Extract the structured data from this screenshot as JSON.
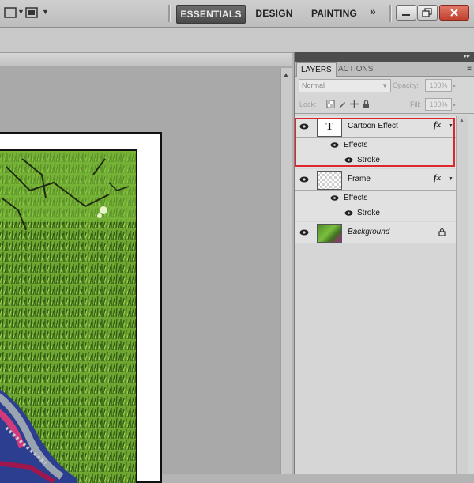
{
  "workspace": {
    "items": [
      "ESSENTIALS",
      "DESIGN",
      "PAINTING"
    ],
    "more": "»"
  },
  "layers_panel": {
    "tabs": [
      "LAYERS",
      "ACTIONS"
    ],
    "blend_mode": "Normal",
    "opacity_label": "Opacity:",
    "opacity_value": "100%",
    "lock_label": "Lock:",
    "fill_label": "Fill:",
    "fill_value": "100%",
    "layers": [
      {
        "name": "Cartoon Effect",
        "thumb": "text",
        "fx": "fx",
        "effects": "Effects",
        "effect_items": [
          "Stroke"
        ]
      },
      {
        "name": "Frame",
        "thumb": "transparent",
        "fx": "fx",
        "effects": "Effects",
        "effect_items": [
          "Stroke"
        ]
      },
      {
        "name": "Background",
        "thumb": "photo",
        "locked": true
      }
    ],
    "thumb_text": "T"
  },
  "colors": {
    "highlight": "#e0262d",
    "active_workspace": "#4f4f4f"
  },
  "icons": [
    "marquee-icon",
    "screen-mode-icon",
    "eye-icon",
    "lock-icon",
    "minimize-icon",
    "restore-icon",
    "close-icon",
    "panel-menu-icon"
  ]
}
